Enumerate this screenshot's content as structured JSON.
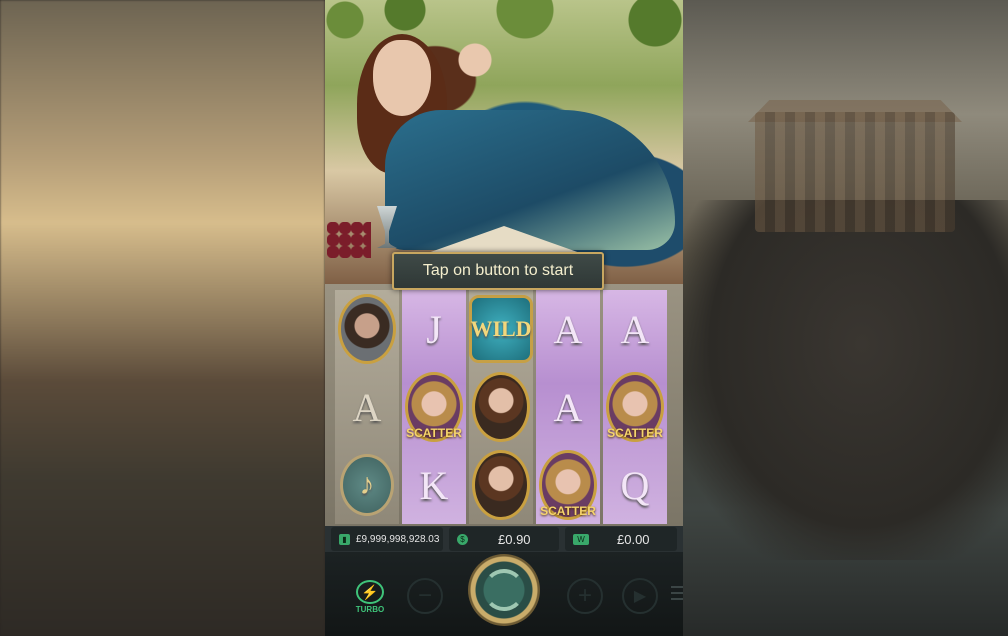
{
  "game": {
    "start_prompt": "Tap on button to start",
    "reels": [
      {
        "style": "plain",
        "symbols": [
          "warrior",
          "A",
          "lyre"
        ]
      },
      {
        "style": "pink",
        "symbols": [
          "J",
          "scatter",
          "K"
        ]
      },
      {
        "style": "plain",
        "symbols": [
          "wild",
          "goddess",
          "goddess"
        ]
      },
      {
        "style": "pink",
        "symbols": [
          "A",
          "A",
          "scatter"
        ]
      },
      {
        "style": "pink",
        "symbols": [
          "A",
          "scatter",
          "Q"
        ]
      }
    ],
    "labels": {
      "J": "J",
      "A": "A",
      "K": "K",
      "Q": "Q",
      "wild": "WILD",
      "scatter": "SCATTER",
      "lyre_glyph": "♪"
    }
  },
  "info": {
    "balance": "£9,999,998,928.03",
    "bet": "£0.90",
    "win": "£0.00"
  },
  "controls": {
    "turbo_label": "TURBO",
    "minus_glyph": "−",
    "plus_glyph": "+",
    "auto_glyph": "▶"
  },
  "colors": {
    "accent_green": "#3fc47a",
    "gold": "#c9a040",
    "pink_reel": "#d7b7e5"
  }
}
